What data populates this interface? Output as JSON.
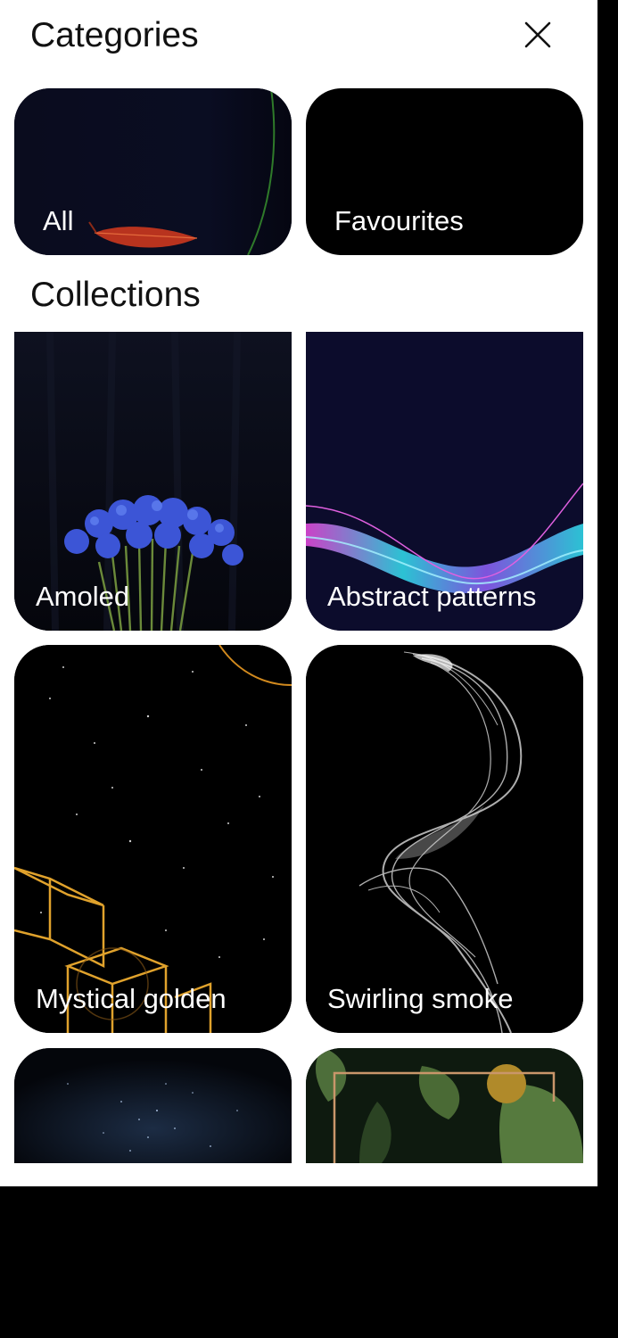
{
  "header": {
    "title": "Categories",
    "close_icon": "close-icon"
  },
  "categories": [
    {
      "label": "All",
      "image": "red-leaf-on-dark"
    },
    {
      "label": "Favourites",
      "image": "black"
    }
  ],
  "collections_section": {
    "title": "Collections",
    "items": [
      {
        "label": "Amoled",
        "image": "blue-cornflowers-on-dark"
      },
      {
        "label": "Abstract patterns",
        "image": "neon-wave"
      },
      {
        "label": "Mystical golden",
        "image": "golden-cubes-starfield"
      },
      {
        "label": "Swirling smoke",
        "image": "white-smoke-ribbon"
      },
      {
        "label": "",
        "image": "starry-sky"
      },
      {
        "label": "",
        "image": "green-leaves-gold-frame"
      }
    ]
  },
  "colors": {
    "sheet_background": "#ffffff",
    "page_background": "#000000",
    "label_text": "#ffffff",
    "title_text": "#111111"
  }
}
